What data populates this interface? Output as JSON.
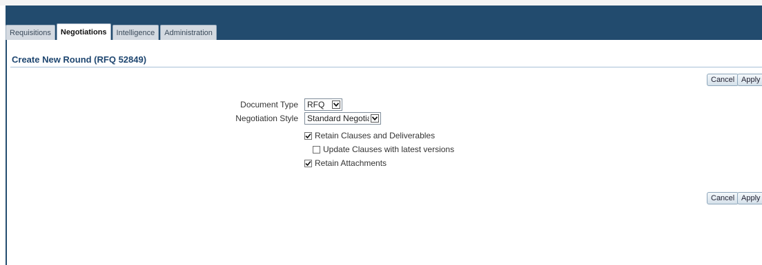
{
  "tabs": [
    {
      "label": "Requisitions",
      "active": false
    },
    {
      "label": "Negotiations",
      "active": true
    },
    {
      "label": "Intelligence",
      "active": false
    },
    {
      "label": "Administration",
      "active": false
    }
  ],
  "page": {
    "title": "Create New Round (RFQ 52849)"
  },
  "buttons": {
    "cancel": "Cancel",
    "apply": "Apply"
  },
  "form": {
    "document_type": {
      "label": "Document Type",
      "value": "RFQ",
      "icon": "chevron-down-icon"
    },
    "negotiation_style": {
      "label": "Negotiation Style",
      "value": "Standard Negotiation",
      "icon": "chevron-down-icon"
    },
    "checkboxes": [
      {
        "label": "Retain Clauses and Deliverables",
        "checked": true
      },
      {
        "label": "Update Clauses with latest versions",
        "checked": false
      },
      {
        "label": "Retain Attachments",
        "checked": true
      }
    ]
  },
  "colors": {
    "header": "#224b6e",
    "title": "#1e4670",
    "accent_rule": "#a7bfd6"
  }
}
